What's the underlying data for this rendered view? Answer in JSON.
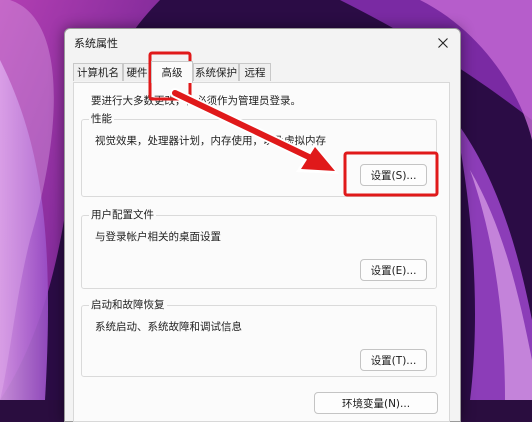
{
  "window": {
    "title": "系统属性"
  },
  "tabs": [
    {
      "label": "计算机名"
    },
    {
      "label": "硬件"
    },
    {
      "label": "高级"
    },
    {
      "label": "系统保护"
    },
    {
      "label": "远程"
    }
  ],
  "active_tab": "高级",
  "admin_note": "要进行大多数更改，你必须作为管理员登录。",
  "performance": {
    "title": "性能",
    "description": "视觉效果，处理器计划，内存使用，以及虚拟内存",
    "button": "设置(S)..."
  },
  "user_profiles": {
    "title": "用户配置文件",
    "description": "与登录帐户相关的桌面设置",
    "button": "设置(E)..."
  },
  "startup_recovery": {
    "title": "启动和故障恢复",
    "description": "系统启动、系统故障和调试信息",
    "button": "设置(T)..."
  },
  "env_button": "环境变量(N)...",
  "colors": {
    "highlight": "#e0191a"
  }
}
